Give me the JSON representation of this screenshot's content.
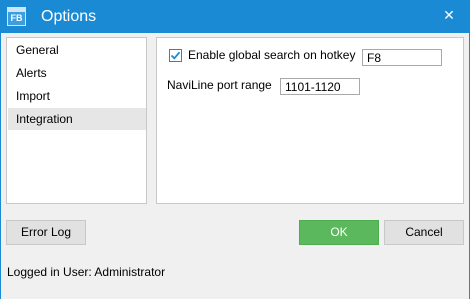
{
  "window": {
    "title": "Options",
    "app_icon_text": "FB",
    "close_glyph": "✕",
    "accent_color": "#1a8ad4"
  },
  "sidebar": {
    "items": [
      {
        "label": "General",
        "selected": false
      },
      {
        "label": "Alerts",
        "selected": false
      },
      {
        "label": "Import",
        "selected": false
      },
      {
        "label": "Integration",
        "selected": true
      }
    ]
  },
  "integration": {
    "global_search": {
      "label": "Enable global search on hotkey",
      "checked": true,
      "hotkey_value": "F8"
    },
    "naviline_port": {
      "label": "NaviLine port range",
      "value": "1101-1120"
    }
  },
  "buttons": {
    "error_log": "Error Log",
    "ok": "OK",
    "cancel": "Cancel",
    "ok_color": "#5cb85c"
  },
  "status": {
    "logged_in_text": "Logged in User: Administrator"
  }
}
